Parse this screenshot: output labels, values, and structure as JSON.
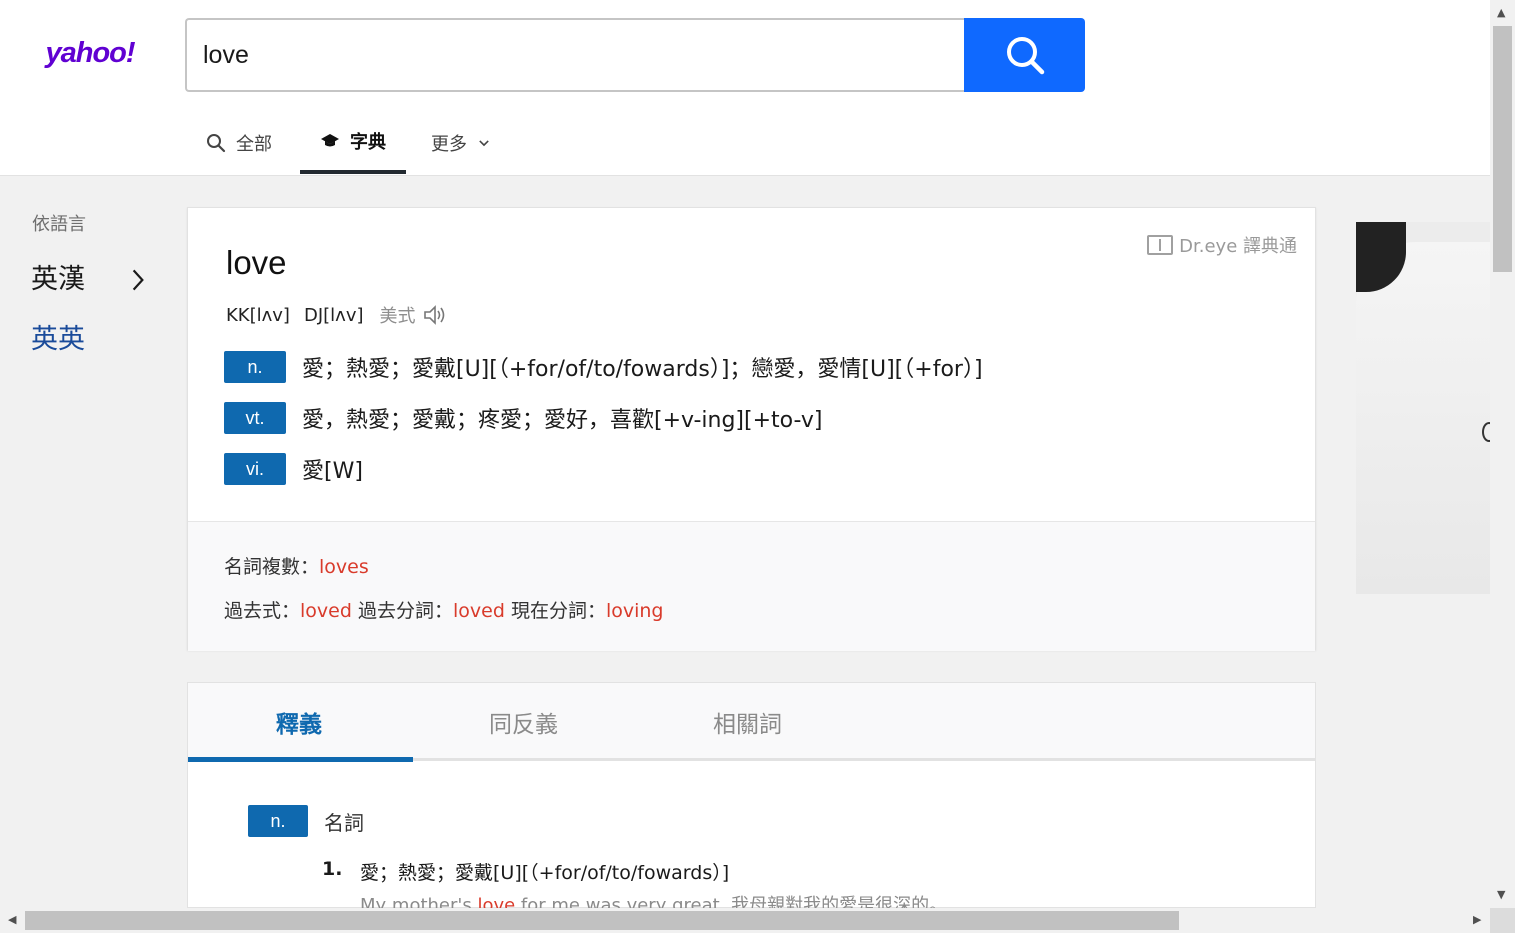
{
  "header": {
    "logo": "yahoo!",
    "search_value": "love",
    "tabs": [
      {
        "label": "全部",
        "icon": "search-icon"
      },
      {
        "label": "字典",
        "icon": "graduation-cap-icon"
      },
      {
        "label": "更多",
        "icon": "chevron-down-icon"
      }
    ]
  },
  "sidebar": {
    "title": "依語言",
    "items": [
      {
        "label": "英漢"
      },
      {
        "label": "英英"
      }
    ]
  },
  "entry": {
    "dreye_label": "Dr.eye 譯典通",
    "word": "love",
    "kk": "KK[lʌv]",
    "dj": "DJ[lʌv]",
    "us_label": "美式",
    "summary": [
      {
        "pos": "n.",
        "text": "愛；熱愛；愛戴[U][（+for/of/to/fowards）]；戀愛，愛情[U][（+for）]"
      },
      {
        "pos": "vt.",
        "text": "愛，熱愛；愛戴；疼愛；愛好，喜歡[+v-ing][+to-v]"
      },
      {
        "pos": "vi.",
        "text": "愛[W]"
      }
    ],
    "forms": {
      "plural_label": "名詞複數：",
      "plural_value": "loves",
      "past_label": "過去式：",
      "past_value": "loved",
      "pp_label": "過去分詞：",
      "pp_value": "loved",
      "presp_label": "現在分詞：",
      "presp_value": "loving"
    }
  },
  "tabs": [
    {
      "label": "釋義",
      "active": true
    },
    {
      "label": "同反義",
      "active": false
    },
    {
      "label": "相關詞",
      "active": false
    }
  ],
  "definitions": {
    "pos": "n.",
    "pos_label": "名詞",
    "items": [
      {
        "num": "1.",
        "text": "愛；熱愛；愛戴[U][（+for/of/to/fowards）]",
        "example_pre": "My mother's ",
        "example_hl": "love",
        "example_post": " for me was very great. 我母親對我的愛是很深的。"
      }
    ]
  },
  "colors": {
    "accent": "#0f69ff",
    "pos_tag": "#0f69af",
    "highlight": "#d93b2b",
    "logo": "#6001d2"
  }
}
